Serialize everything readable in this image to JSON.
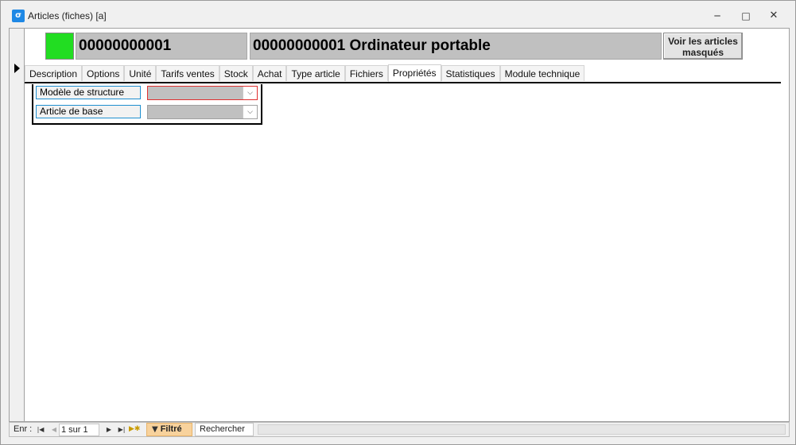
{
  "window": {
    "title": "Articles (fiches) [a]",
    "icon": "form-icon",
    "controls": {
      "minimize": "─",
      "maximize": "□",
      "close": "✕"
    }
  },
  "header": {
    "status_color": "#22dd22",
    "code": "00000000001",
    "name": "00000000001 Ordinateur portable",
    "hidden_button_label": "Voir les articles masqués"
  },
  "tabs": [
    {
      "label": "Description",
      "active": false
    },
    {
      "label": "Options",
      "active": false
    },
    {
      "label": "Unité",
      "active": false
    },
    {
      "label": "Tarifs ventes",
      "active": false
    },
    {
      "label": "Stock",
      "active": false
    },
    {
      "label": "Achat",
      "active": false
    },
    {
      "label": "Type article",
      "active": false
    },
    {
      "label": "Fichiers",
      "active": false
    },
    {
      "label": "Propriétés",
      "active": true
    },
    {
      "label": "Statistiques",
      "active": false
    },
    {
      "label": "Module technique",
      "active": false
    }
  ],
  "properties": {
    "structure_model_label": "Modèle de structure",
    "structure_model_value": "",
    "base_article_label": "Article de base",
    "base_article_value": ""
  },
  "navigation": {
    "label": "Enr :",
    "record": "1 sur 1",
    "filter_label": "Filtré",
    "search_label": "Rechercher"
  },
  "colors": {
    "status": "#22dd22",
    "field_border": "#1f8fd0",
    "invalid_border": "#e03030",
    "filter_bg": "#f8d29c"
  }
}
